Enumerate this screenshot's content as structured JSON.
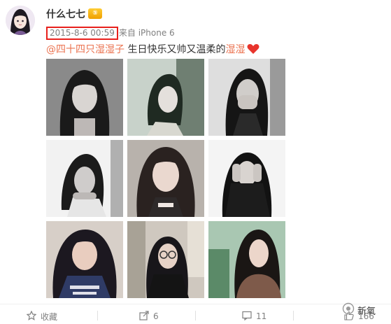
{
  "post": {
    "username": "什么七七",
    "vip_badge": "⑤",
    "timestamp": "2015-8-6 00:59",
    "source": "来自 iPhone 6",
    "mention": "@四十四只湿湿子",
    "text_middle": " 生日快乐又帅又温柔的",
    "text_highlight": "湿湿",
    "heart_icon": "heart-icon",
    "photos": [
      "photo-1",
      "photo-2",
      "photo-3",
      "photo-4",
      "photo-5",
      "photo-6",
      "photo-7",
      "photo-8",
      "photo-9"
    ]
  },
  "actions": {
    "favorite_label": "收藏",
    "repost_count": "6",
    "comment_count": "11",
    "like_count": "166"
  },
  "watermark": {
    "text": "新氧"
  },
  "colors": {
    "link": "#eb7350",
    "highlight_box": "#e8201c",
    "meta_gray": "#808080"
  }
}
